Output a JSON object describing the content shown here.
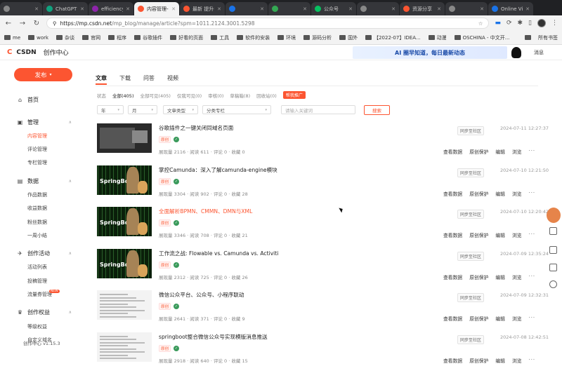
{
  "browser": {
    "tabs": [
      {
        "title": "",
        "fav_color": "#888888",
        "active": false
      },
      {
        "title": "ChatGPT",
        "fav_color": "#10a37f",
        "active": false
      },
      {
        "title": "efficiency",
        "fav_color": "#8e24aa",
        "active": false
      },
      {
        "title": "内容管理-CSDN",
        "fav_color": "#fc5531",
        "active": true
      },
      {
        "title": "最新 提升中",
        "fav_color": "#fc5531",
        "active": false
      },
      {
        "title": "",
        "fav_color": "#1a73e8",
        "active": false
      },
      {
        "title": "",
        "fav_color": "#34a853",
        "active": false
      },
      {
        "title": "公众号",
        "fav_color": "#07c160",
        "active": false
      },
      {
        "title": "",
        "fav_color": "#888888",
        "active": false
      },
      {
        "title": "资源分享",
        "fav_color": "#fc5531",
        "active": false
      },
      {
        "title": "",
        "fav_color": "#888888",
        "active": false
      },
      {
        "title": "Online Video",
        "fav_color": "#1a73e8",
        "active": false
      }
    ],
    "url_host": "https://mp.csdn.net",
    "url_path": "/mp_blog/manage/article?spm=1011.2124.3001.5298",
    "bookmarks": [
      "me",
      "work",
      "杂谈",
      "官网",
      "程序",
      "谷歌插件",
      "好看的页面",
      "工具",
      "软件的安装",
      "环境",
      "源码分析",
      "国外",
      "【2022-07】IDEA...",
      "动漫",
      "OSCHINA - 中文开..."
    ],
    "bookmarks_all": "所有书签"
  },
  "header": {
    "logo_mark": "C",
    "logo_text": "CSDN",
    "center": "创作中心",
    "banner": "AI 圈早知道，每日最新动态",
    "messages": "消息"
  },
  "sidebar": {
    "publish_label": "发布",
    "groups": [
      {
        "label": "首页",
        "icon": "home-icon",
        "items": []
      },
      {
        "label": "管理",
        "icon": "manage-icon",
        "items": [
          "内容管理",
          "评论管理",
          "专栏管理"
        ]
      },
      {
        "label": "数据",
        "icon": "data-icon",
        "items": [
          "作品数据",
          "收益数据",
          "粉丝数据",
          "一周小结"
        ]
      },
      {
        "label": "创作活动",
        "icon": "activity-icon",
        "items": [
          "活动列表",
          "投稿管理",
          "流量券管理"
        ]
      },
      {
        "label": "创作权益",
        "icon": "rights-icon",
        "items": [
          "等级权益",
          "自定义域名"
        ]
      }
    ],
    "active_item": "内容管理",
    "new_badge": "NEW",
    "version": "创作中心 v1.15.3"
  },
  "content_tabs": [
    "文章",
    "下载",
    "问答",
    "视频"
  ],
  "filters": {
    "label": "状态",
    "items": [
      "全部(405)",
      "全部可见(405)",
      "仅我可见(0)",
      "审核(0)",
      "草稿箱(8)",
      "回收站(0)"
    ],
    "promo": "帮我推广"
  },
  "selects": {
    "year": "年",
    "month": "月",
    "type": "文章类型",
    "column": "分类专栏",
    "keyword_placeholder": "请输入关键词",
    "search_label": "搜索"
  },
  "articles": [
    {
      "title": "谷歌插件之一键关闭同域名页面",
      "orig": "原创",
      "stats": "展现量 2116 · 阅读 611 · 评论 0 · 收藏 0",
      "sync": "同步至社区",
      "date": "2024-07-11 12:27:37",
      "thumb": "screenshot",
      "highlight": false
    },
    {
      "title": "掌控Camunda：深入了解camunda-engine模块",
      "orig": "原创",
      "stats": "展现量 3304 · 阅读 902 · 评论 0 · 收藏 28",
      "sync": "同步至社区",
      "date": "2024-07-10 12:21:50",
      "thumb": "matrix",
      "highlight": false
    },
    {
      "title": "全面解析BPMN、CMMN、DMN与XML",
      "orig": "原创",
      "stats": "展现量 3346 · 阅读 708 · 评论 0 · 收藏 21",
      "sync": "同步至社区",
      "date": "2024-07-10 12:20:42",
      "thumb": "matrix",
      "highlight": true
    },
    {
      "title": "工作流之战: Flowable vs. Camunda vs. Activiti",
      "orig": "原创",
      "stats": "展现量 2312 · 阅读 725 · 评论 0 · 收藏 26",
      "sync": "同步至社区",
      "date": "2024-07-09 12:35:24",
      "thumb": "matrix",
      "highlight": false
    },
    {
      "title": "微信公众平台、公众号、小程序联动",
      "orig": "原创",
      "stats": "展现量 2641 · 阅读 371 · 评论 0 · 收藏 9",
      "sync": "同步至社区",
      "date": "2024-07-09 12:32:31",
      "thumb": "doc",
      "highlight": false
    },
    {
      "title": "springboot整合微信公众号实现模版消息推送",
      "orig": "原创",
      "stats": "展现量 2918 · 阅读 640 · 评论 0 · 收藏 15",
      "sync": "同步至社区",
      "date": "2024-07-08 12:42:51",
      "thumb": "doc",
      "highlight": false
    }
  ],
  "actions": [
    "查看数据",
    "原创保护",
    "编辑",
    "浏览",
    "···"
  ]
}
